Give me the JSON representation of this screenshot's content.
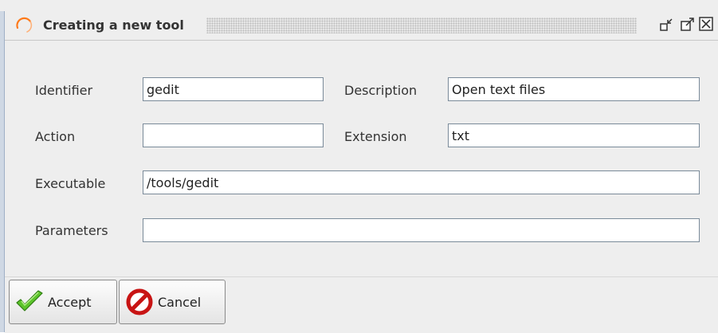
{
  "window": {
    "title": "Creating a new tool",
    "icons": {
      "app": "spinner-arc-icon",
      "minimize": "minimize-window-icon",
      "maximize": "maximize-window-icon",
      "close": "close-window-icon"
    },
    "colors": {
      "accent": "#ff7a1a",
      "frame": "#9fb0c6"
    }
  },
  "form": {
    "identifier": {
      "label": "Identifier",
      "value": "gedit"
    },
    "description": {
      "label": "Description",
      "value": "Open text files"
    },
    "action": {
      "label": "Action",
      "value": ""
    },
    "extension": {
      "label": "Extension",
      "value": "txt"
    },
    "executable": {
      "label": "Executable",
      "value": "/tools/gedit"
    },
    "parameters": {
      "label": "Parameters",
      "value": ""
    }
  },
  "buttons": {
    "accept": {
      "label": "Accept",
      "icon": "checkmark-icon"
    },
    "cancel": {
      "label": "Cancel",
      "icon": "prohibited-icon"
    }
  }
}
